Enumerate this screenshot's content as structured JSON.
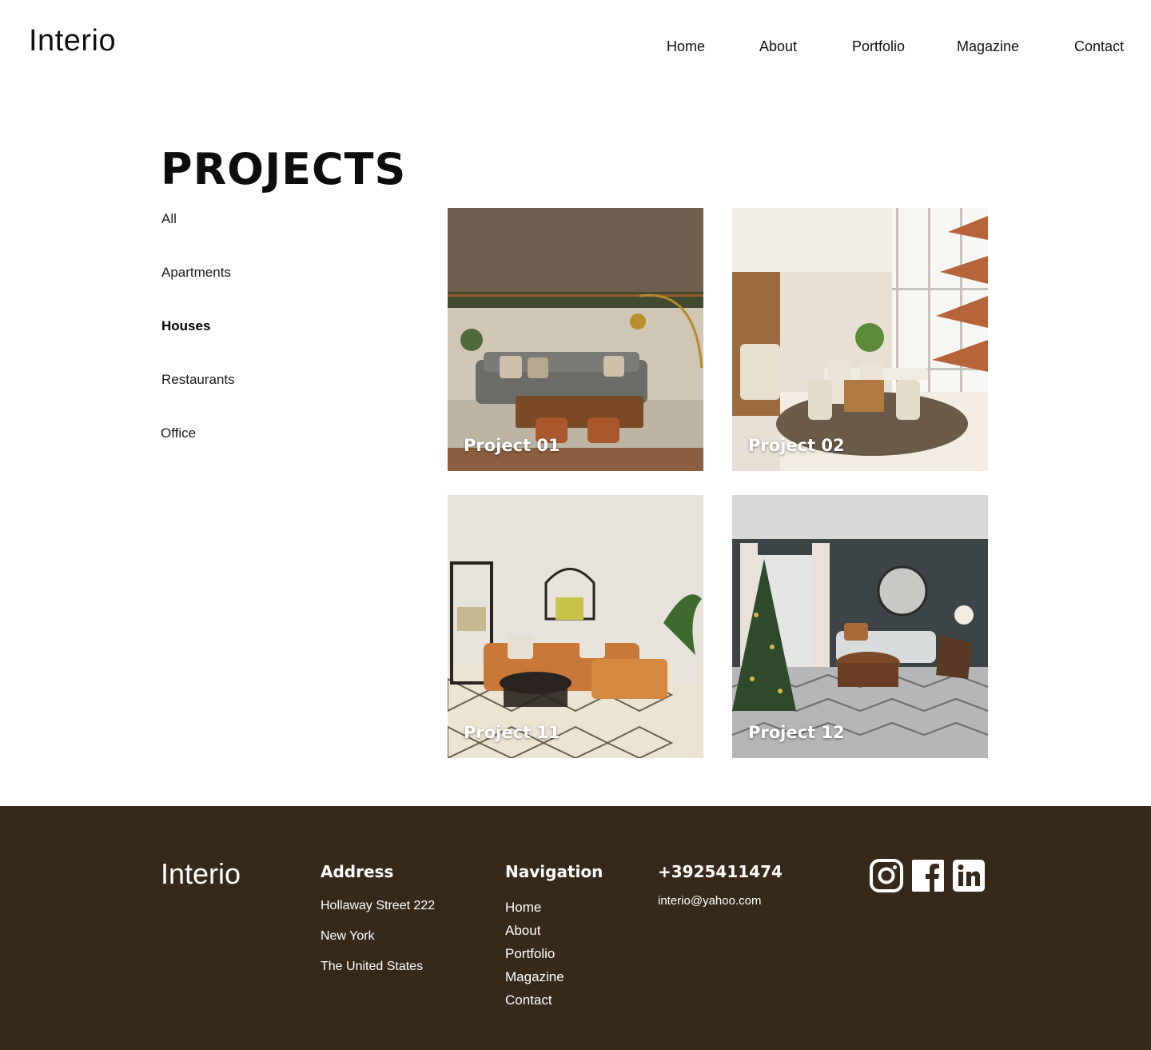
{
  "header": {
    "logo": "Interio",
    "nav": [
      "Home",
      "About",
      "Portfolio",
      "Magazine",
      "Contact"
    ]
  },
  "main": {
    "title": "PROJECTS",
    "filters": [
      "All",
      "Apartments",
      "Houses",
      "Restaurants",
      "Office"
    ],
    "active_filter": "Houses",
    "projects": [
      {
        "label": "Project 01"
      },
      {
        "label": "Project 02"
      },
      {
        "label": "Project 11"
      },
      {
        "label": "Project 12"
      }
    ]
  },
  "footer": {
    "logo": "Interio",
    "address": {
      "heading": "Address",
      "lines": [
        "Hollaway Street 222",
        "New York",
        "The United States"
      ]
    },
    "navigation": {
      "heading": "Navigation",
      "links": [
        "Home",
        "About",
        "Portfolio",
        "Magazine",
        "Contact"
      ]
    },
    "contact": {
      "phone": "+3925411474",
      "email": "interio@yahoo.com"
    },
    "social": [
      "instagram-icon",
      "facebook-icon",
      "linkedin-icon"
    ]
  },
  "colors": {
    "footer_bg": "#36291a",
    "text": "#111111",
    "white": "#ffffff"
  }
}
